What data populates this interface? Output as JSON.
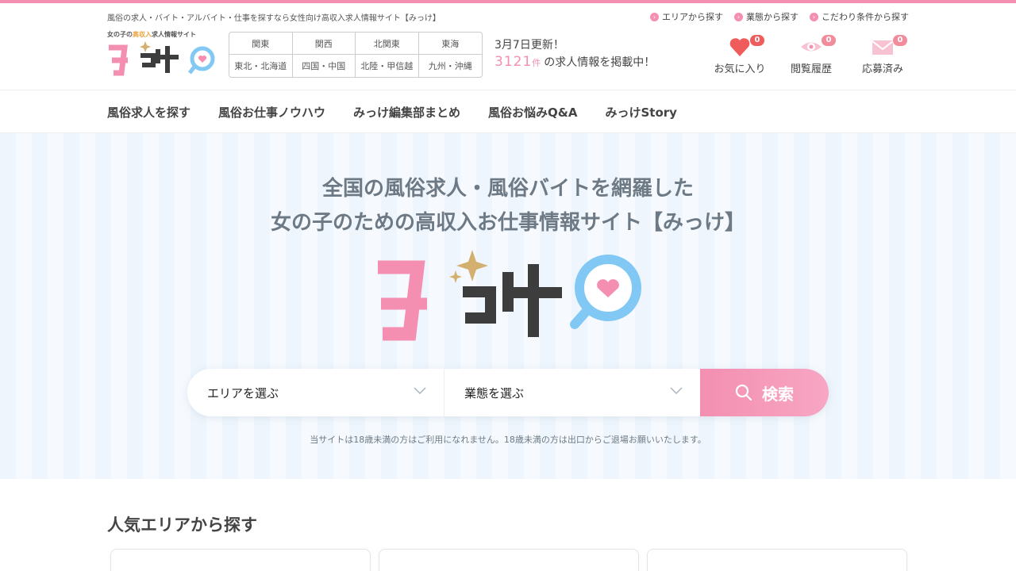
{
  "header": {
    "tagline": "風俗の求人・バイト・アルバイト・仕事を探すなら女性向け高収入求人情報サイト【みっけ】",
    "quicklinks": [
      {
        "label": "エリアから探す"
      },
      {
        "label": "業態から探す"
      },
      {
        "label": "こだわり条件から探す"
      }
    ],
    "logo": {
      "sub_pre": "女の子の",
      "sub_highlight": "高収入",
      "sub_post": "求人情報サイト",
      "name": "みっけ"
    },
    "regions": [
      "関東",
      "関西",
      "北関東",
      "東海",
      "東北・北海道",
      "四国・中国",
      "北陸・甲信越",
      "九州・沖縄"
    ],
    "update_text": "3月7日更新！",
    "job_count": "3121",
    "job_count_unit": "件",
    "job_count_suffix": "の求人情報を掲載中！",
    "icons": [
      {
        "label": "お気に入り",
        "count": "0",
        "icon": "heart-icon"
      },
      {
        "label": "閲覧履歴",
        "count": "0",
        "icon": "eye-icon"
      },
      {
        "label": "応募済み",
        "count": "0",
        "icon": "mail-icon"
      }
    ]
  },
  "nav": {
    "items": [
      "風俗求人を探す",
      "風俗お仕事ノウハウ",
      "みっけ編集部まとめ",
      "風俗お悩みQ&A",
      "みっけStory"
    ]
  },
  "hero": {
    "title_line1": "全国の風俗求人・風俗バイトを網羅した",
    "title_line2": "女の子のための高収入お仕事情報サイト【みっけ】",
    "area_placeholder": "エリアを選ぶ",
    "type_placeholder": "業態を選ぶ",
    "search_label": "検索",
    "notice": "当サイトは18歳未満の方はご利用になれません。18歳未満の方は出口からご退場お願いいたします。"
  },
  "popular": {
    "title": "人気エリアから探す"
  },
  "colors": {
    "accent": "#f48fb1",
    "logo_dark": "#3d3d3d",
    "logo_blue": "#82c8f5",
    "sparkle": "#d4b070"
  }
}
